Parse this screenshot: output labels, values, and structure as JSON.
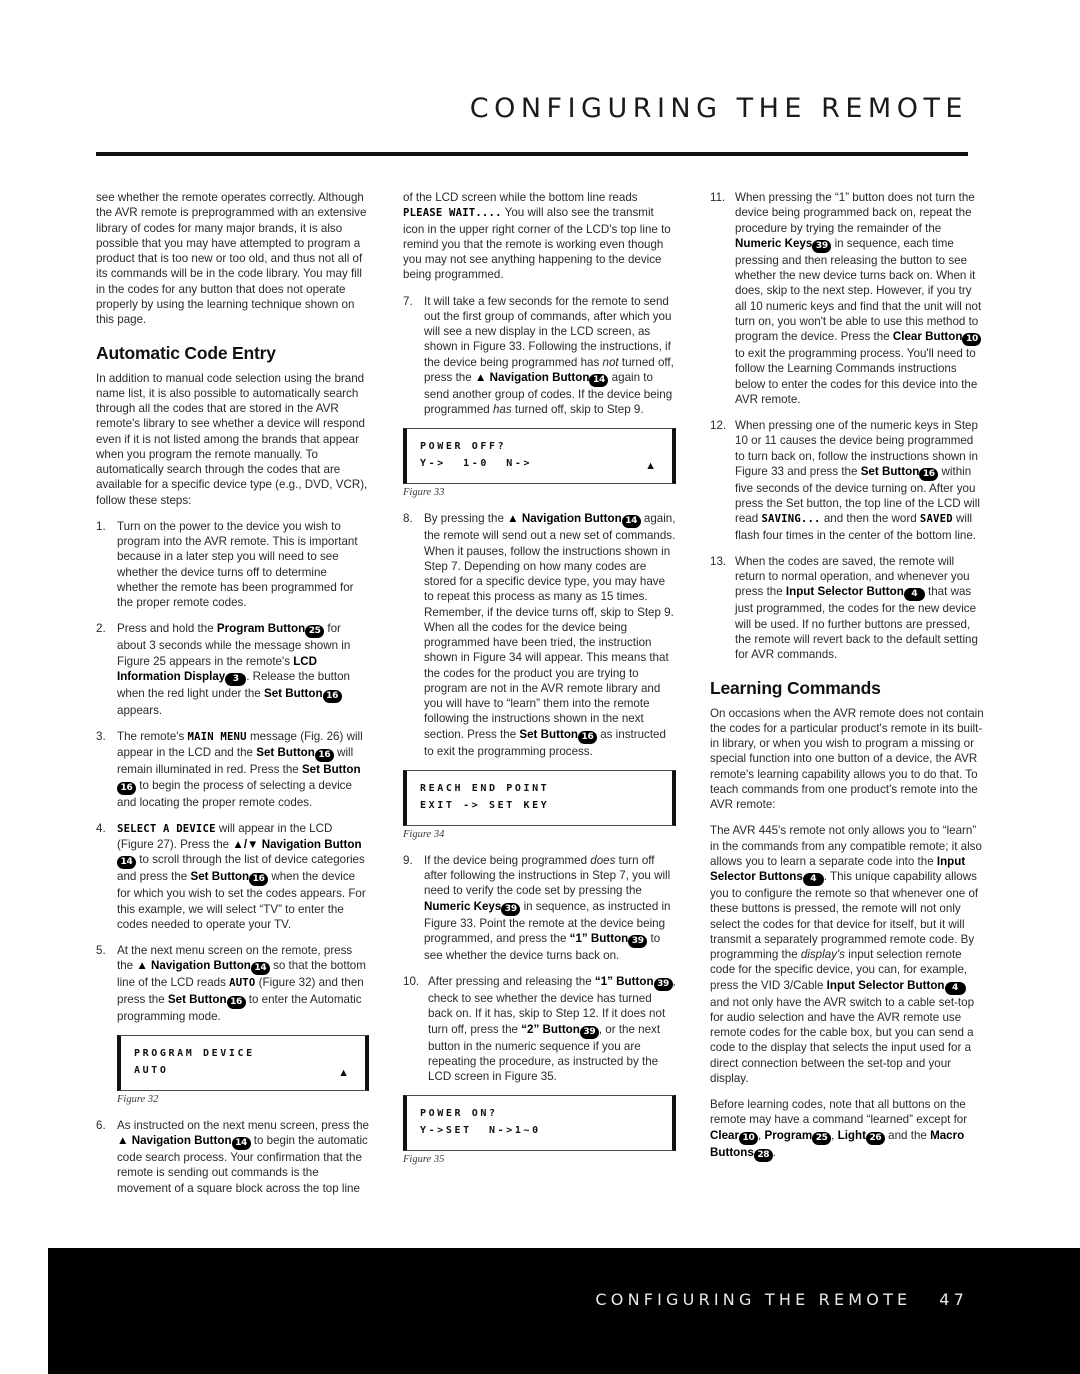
{
  "header": {
    "title": "CONFIGURING THE REMOTE"
  },
  "footer": {
    "text": "CONFIGURING THE REMOTE   47",
    "chapter": "CONFIGURING THE REMOTE",
    "page_number": "47"
  },
  "col1": {
    "intro": "see whether the remote operates correctly. Although the AVR remote is preprogrammed with an extensive library of codes for many major brands, it is also possible that you may have attempted to program a product that is too new or too old, and thus not all of its commands will be in the code library. You may fill in the codes for any button that does not operate properly by using the learning technique shown on this page.",
    "heading": "Automatic Code Entry",
    "para1": "In addition to manual code selection using the brand name list, it is also possible to automatically search through all the codes that are stored in the AVR remote's library to see whether a device will respond even if it is not listed among the brands that appear when you program the remote manually. To automatically search through the codes that are available for a specific device type (e.g., DVD, VCR), follow these steps:",
    "step1_num": "1.",
    "step1": "Turn on the power to the device you wish to program into the AVR remote. This is important because in a later step you will need to see whether the device turns off to determine whether the remote has been programmed for the proper remote codes.",
    "step2_num": "2.",
    "step2_a": "Press and hold the ",
    "step2_b": "Program Button",
    "step2_badge1": "25",
    "step2_c": " for about 3 seconds while the message shown in Figure 25 appears in the remote's ",
    "step2_d": "LCD Information Display",
    "step2_badge2": "3",
    "step2_e": ". Release the button when the red light under the ",
    "step2_f": "Set Button",
    "step2_badge3": "16",
    "step2_g": " appears.",
    "step3_num": "3.",
    "step3_a": "The remote's ",
    "step3_lcd": "MAIN MENU",
    "step3_b": " message (Fig. 26) will appear in the LCD and the ",
    "step3_c": "Set Button",
    "step3_badge1": "16",
    "step3_d": " will remain illuminated in red. Press the ",
    "step3_e": "Set Button",
    "step3_badge2": "16",
    "step3_f": " to begin the process of selecting a device and locating the proper remote codes.",
    "step4_num": "4.",
    "step4_lcd": "SELECT A DEVICE",
    "step4_a": " will appear in the LCD (Figure 27). Press the ",
    "step4_b": "▲/▼ Navigation Button",
    "step4_badge1": "14",
    "step4_c": " to scroll through the list of device categories and press the ",
    "step4_d": "Set Button",
    "step4_badge2": "16",
    "step4_e": " when the device for which you wish to set the codes appears. For this example, we will select “TV” to enter the codes needed to operate your TV.",
    "step5_num": "5.",
    "step5_a": "At the next menu screen on the remote, press the ",
    "step5_b": "▲ Navigation Button",
    "step5_badge1": "14",
    "step5_c": " so that the bottom line of the LCD reads ",
    "step5_lcd": "AUTO",
    "step5_d": " (Figure 32) and then press the ",
    "step5_e": "Set Button",
    "step5_badge2": "16",
    "step5_f": " to enter the Automatic programming mode.",
    "fig32_line1": "PROGRAM DEVICE",
    "fig32_line2": "AUTO",
    "fig32_arrow": "▲",
    "fig32_cap": "Figure 32",
    "step6_num": "6.",
    "step6_a": "As instructed on the next menu screen, press the ",
    "step6_b": "▲ Navigation Button",
    "step6_badge1": "14",
    "step6_c": " to begin the automatic code search process. Your confirmation that the remote is sending out commands is the movement of a square block across the top line"
  },
  "col2": {
    "cont_a": "of the LCD screen while the bottom line reads ",
    "cont_lcd": "PLEASE WAIT....",
    "cont_b": " You will also see the transmit icon in the upper right corner of the LCD's top line to remind you that the remote is working even though you may not see anything happening to the device being programmed.",
    "step7_num": "7.",
    "step7_a": "It will take a few seconds for the remote to send out the first group of commands, after which you will see a new display in the LCD screen, as shown in Figure 33. Following the instructions, if the device being programmed has ",
    "step7_i1": "not",
    "step7_b": " turned off, press the ",
    "step7_c": "▲ Navigation Button",
    "step7_badge1": "14",
    "step7_d": " again to send another group of codes. If the device being programmed ",
    "step7_i2": "has",
    "step7_e": " turned off, skip to Step 9.",
    "fig33_line1": "POWER OFF?",
    "fig33_line2": "Y->  1-0  N->",
    "fig33_arrow": "▲",
    "fig33_cap": "Figure 33",
    "step8_num": "8.",
    "step8_a": "By pressing the ",
    "step8_b": "▲ Navigation Button",
    "step8_badge1": "14",
    "step8_c": " again, the remote will send out a new set of commands. When it pauses, follow the instructions shown in Step 7. Depending on how many codes are stored for a specific device type, you may have to repeat this process as many as 15 times. Remember, if the device turns off, skip to Step 9. When all the codes for the device being programmed have been tried, the instruction shown in Figure 34 will appear. This means that the codes for the product you are trying to program are not in the AVR remote library and you will have to “learn” them into the remote following the instructions shown in the next section. Press the ",
    "step8_d": "Set Button",
    "step8_badge2": "16",
    "step8_e": " as instructed to exit the programming process.",
    "fig34_line1": "REACH END POINT",
    "fig34_line2": "EXIT -> SET KEY",
    "fig34_cap": "Figure 34",
    "step9_num": "9.",
    "step9_a": "If the device being programmed ",
    "step9_i1": "does",
    "step9_b": " turn off after following the instructions in Step 7, you will need to verify the code set by pressing the ",
    "step9_c": "Numeric Keys",
    "step9_badge1": "39",
    "step9_d": " in sequence, as instructed in Figure 33. Point the remote at the device being programmed, and press the ",
    "step9_e": "“1” Button",
    "step9_badge2": "39",
    "step9_f": " to see whether the device turns back on.",
    "step10_num": "10.",
    "step10_a": "After pressing and releasing the ",
    "step10_b": "“1” Button",
    "step10_badge1": "39",
    "step10_c": ", check to see whether the device has turned back on. If it has, skip to Step 12. If it does not turn off, press the ",
    "step10_d": "“2” Button",
    "step10_badge2": "39",
    "step10_e": ", or the next button in the numeric sequence if you are repeating the procedure, as instructed by the LCD screen in Figure 35.",
    "fig35_line1": "POWER ON?",
    "fig35_line2": "Y->SET  N->1~0",
    "fig35_cap": "Figure 35"
  },
  "col3": {
    "step11_num": "11.",
    "step11_a": "When pressing the “1” button does not turn the device being programmed back on, repeat the procedure by trying the remainder of the ",
    "step11_b": "Numeric Keys",
    "step11_badge1": "39",
    "step11_c": " in sequence, each time pressing and then releasing the button to see whether the new device turns back on. When it does, skip to the next step. However, if you try all 10 numeric keys and find that the unit will not turn on, you won't be able to use this method to program the device. Press the ",
    "step11_d": "Clear Button",
    "step11_badge2": "10",
    "step11_e": " to exit the programming process. You'll need to follow the Learning Commands instructions below to enter the codes for this device into the AVR remote.",
    "step12_num": "12.",
    "step12_a": "When pressing one of the numeric keys in Step 10 or 11 causes the device being programmed to turn back on, follow the instructions shown in Figure 33 and press the ",
    "step12_b": "Set Button",
    "step12_badge1": "16",
    "step12_c": " within five seconds of the device turning on. After you press the Set button, the top line of the LCD will read ",
    "step12_lcd1": "SAVING...",
    "step12_d": " and then the word ",
    "step12_lcd2": "SAVED",
    "step12_e": " will flash four times in the center of the bottom line.",
    "step13_num": "13.",
    "step13_a": "When the codes are saved, the remote will return to normal operation, and whenever you press the ",
    "step13_b": "Input Selector Button",
    "step13_badge1": "4",
    "step13_c": " that was just programmed, the codes for the new device will be used. If no further buttons are pressed, the remote will revert back to the default setting for AVR commands.",
    "heading": "Learning Commands",
    "para1": "On occasions when the AVR remote does not contain the codes for a particular product's remote in its built-in library, or when you wish to program a missing or special function into one button of a device, the AVR remote's learning capability allows you to do that. To teach commands from one product's remote into the AVR remote:",
    "para2_a": "The AVR 445's remote not only allows you to “learn” in the commands from any compatible remote; it also allows you to learn a separate code into the ",
    "para2_b": "Input Selector Buttons",
    "para2_badge1": "4",
    "para2_c": ". This unique capability allows you to configure the remote so that whenever one of these buttons is pressed, the remote will not only select the codes for that device for itself, but it will transmit a separately programmed remote code. By programming the ",
    "para2_i1": "display's",
    "para2_d": " input selection remote code for the specific device, you can, for example, press the VID 3/Cable ",
    "para2_e": "Input Selector Button",
    "para2_badge2": "4",
    "para2_f": " and not only have the AVR switch to a cable set-top for audio selection and have the AVR remote use remote codes for the cable box, but you can send a code to the display that selects the input used for a direct connection between the set-top and your display.",
    "para3_a": "Before learning codes, note that all buttons on the remote may have a command “learned” except for ",
    "para3_b": "Clear",
    "para3_badge1": "10",
    "para3_c": ", ",
    "para3_d": "Program",
    "para3_badge2": "25",
    "para3_e": ", ",
    "para3_f": "Light",
    "para3_badge3": "26",
    "para3_g": " and the ",
    "para3_h": "Macro Buttons",
    "para3_badge4": "28",
    "para3_i": "."
  },
  "colors": {
    "text": "#2a2a2a",
    "rule": "#111111",
    "footer_bg": "#000000",
    "footer_text": "#e8e8e8"
  }
}
